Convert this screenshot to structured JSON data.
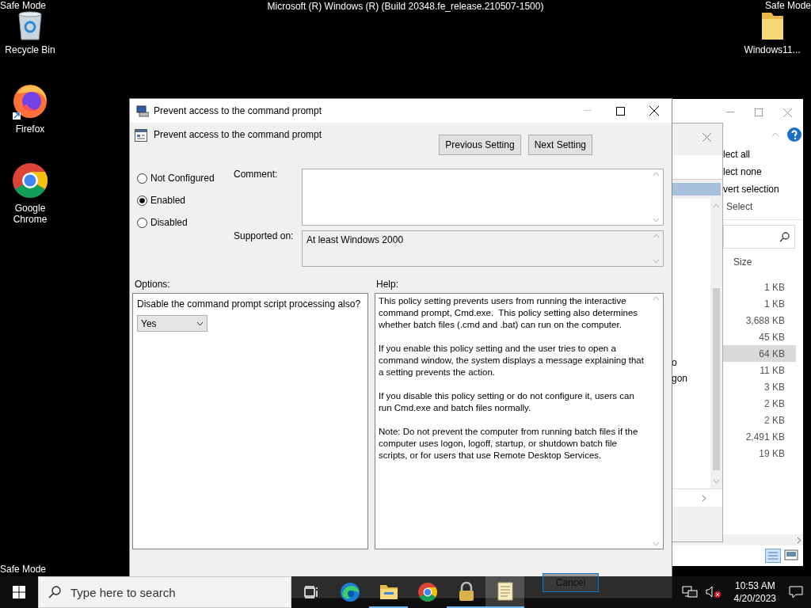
{
  "desktop": {
    "corner_labels": [
      {
        "text": "Safe Mode",
        "kind": "top-left"
      },
      {
        "text": "Safe Mode",
        "kind": "top-right"
      },
      {
        "text": "Safe Mode",
        "kind": "bottom-left"
      }
    ],
    "build_text": "Microsoft (R) Windows (R) (Build 20348.fe_release.210507-1500)",
    "icons": [
      {
        "label": "Recycle Bin",
        "kind": "recycle"
      },
      {
        "label": "Firefox",
        "kind": "firefox"
      },
      {
        "label": "Google Chrome",
        "kind": "chrome"
      },
      {
        "label": "Windows11...",
        "kind": "folder"
      }
    ]
  },
  "explorer_window": {
    "ribbon_items": [
      "lect all",
      "lect none",
      "vert selection"
    ],
    "ribbon_group": "Select",
    "size_header": "Size",
    "rows": [
      {
        "size": "1 KB",
        "selected": false
      },
      {
        "size": "1 KB",
        "selected": false
      },
      {
        "size": "3,688 KB",
        "selected": false
      },
      {
        "size": "45 KB",
        "selected": false
      },
      {
        "size": "64 KB",
        "selected": true
      },
      {
        "size": "11 KB",
        "selected": false
      },
      {
        "size": "3 KB",
        "selected": false
      },
      {
        "size": "2 KB",
        "selected": false
      },
      {
        "size": "2 KB",
        "selected": false
      },
      {
        "size": "2,491 KB",
        "selected": false
      },
      {
        "size": "19 KB",
        "selected": false
      }
    ]
  },
  "back_dialog": {
    "list_fragments": [
      "o",
      "gon"
    ]
  },
  "dialog": {
    "title": "Prevent access to the command prompt",
    "heading": "Prevent access to the command prompt",
    "nav_buttons": [
      "Previous Setting",
      "Next Setting"
    ],
    "states": [
      {
        "label": "Not Configured",
        "selected": false
      },
      {
        "label": "Enabled",
        "selected": true
      },
      {
        "label": "Disabled",
        "selected": false
      }
    ],
    "comment_label": "Comment:",
    "supported_label": "Supported on:",
    "supported_value": "At least Windows 2000",
    "options_label": "Options:",
    "help_label": "Help:",
    "option_text": "Disable the command prompt script processing also?",
    "option_value": "Yes",
    "help_paragraphs": [
      "This policy setting prevents users from running the interactive command prompt, Cmd.exe.  This policy setting also determines whether batch files (.cmd and .bat) can run on the computer.",
      "If you enable this policy setting and the user tries to open a command window, the system displays a message explaining that a setting prevents the action.",
      "If you disable this policy setting or do not configure it, users can run Cmd.exe and batch files normally.",
      "Note: Do not prevent the computer from running batch files if the computer uses logon, logoff, startup, or shutdown batch file scripts, or for users that use Remote Desktop Services."
    ],
    "footer_button": "Cancel"
  },
  "taskbar": {
    "search_placeholder": "Type here to search",
    "apps": [
      {
        "kind": "taskview",
        "running": false,
        "selected": false
      },
      {
        "kind": "edge",
        "running": false,
        "selected": false
      },
      {
        "kind": "explorer",
        "running": true,
        "selected": false
      },
      {
        "kind": "chrome",
        "running": false,
        "selected": false
      },
      {
        "kind": "lock",
        "running": true,
        "selected": false
      },
      {
        "kind": "notepad",
        "running": true,
        "selected": true
      }
    ],
    "time": "10:53 AM",
    "date": "4/20/2023"
  }
}
